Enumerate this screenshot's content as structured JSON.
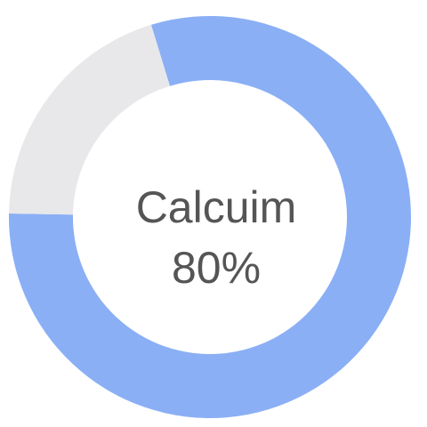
{
  "chart_data": {
    "type": "pie",
    "subtype": "donut",
    "center_label": "Calcuim",
    "center_value_text": "80%",
    "slices": [
      {
        "value": 80,
        "color": "#8aaff5"
      },
      {
        "value": 20,
        "color": "#e8e8ea"
      }
    ]
  }
}
